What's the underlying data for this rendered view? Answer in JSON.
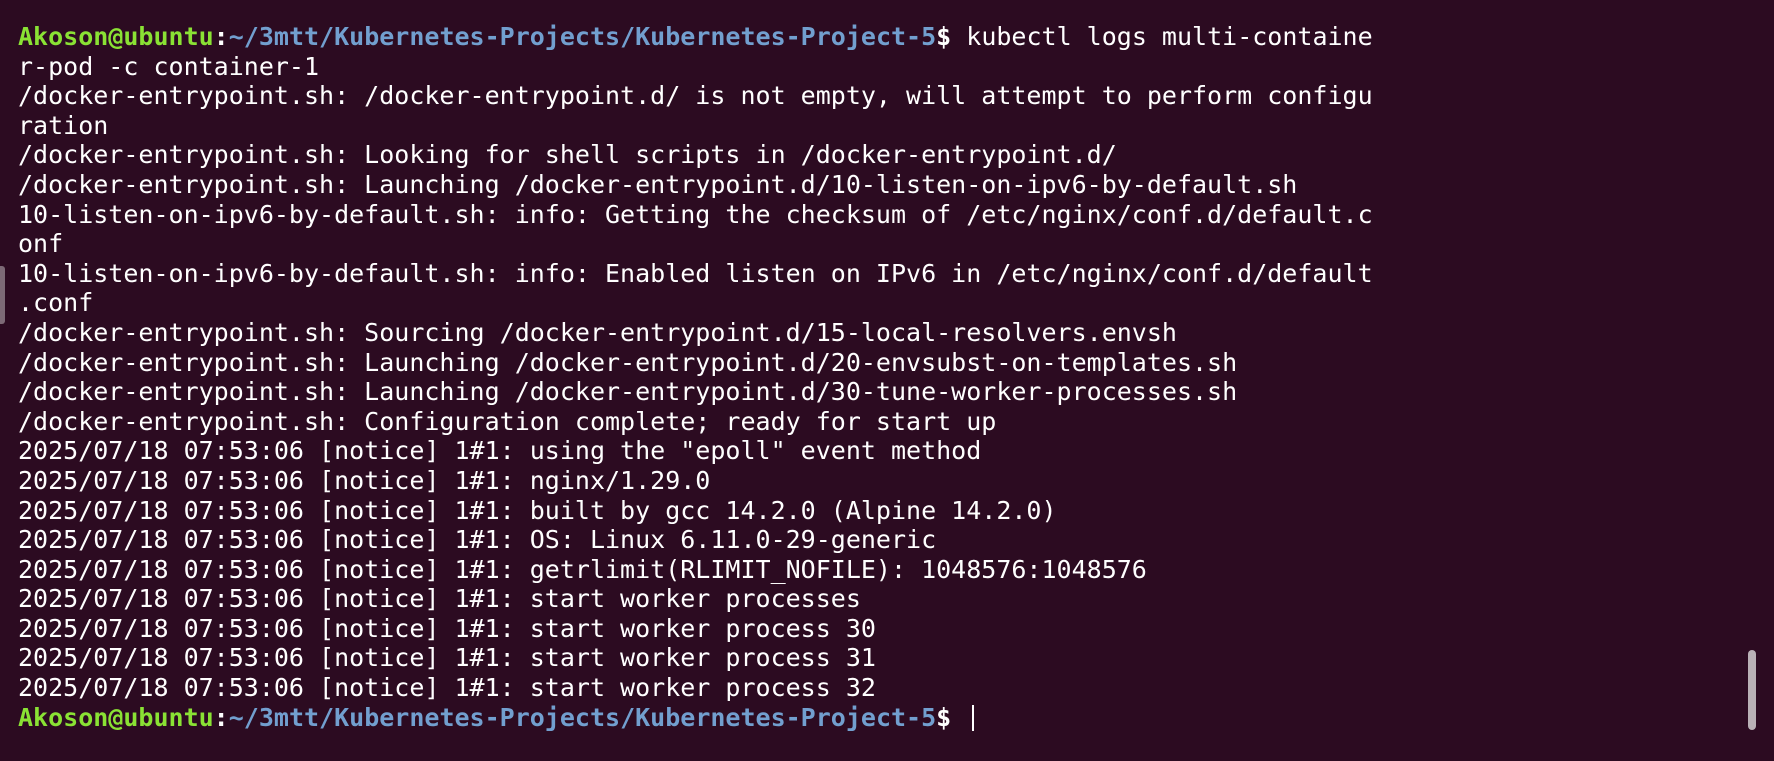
{
  "prompt": {
    "user_host": "Akoson@ubuntu",
    "colon": ":",
    "path": "~/3mtt/Kubernetes-Projects/Kubernetes-Project-5",
    "dollar": "$ "
  },
  "command": "kubectl logs multi-containe",
  "output_lines": [
    "r-pod -c container-1",
    "/docker-entrypoint.sh: /docker-entrypoint.d/ is not empty, will attempt to perform configu",
    "ration",
    "/docker-entrypoint.sh: Looking for shell scripts in /docker-entrypoint.d/",
    "/docker-entrypoint.sh: Launching /docker-entrypoint.d/10-listen-on-ipv6-by-default.sh",
    "10-listen-on-ipv6-by-default.sh: info: Getting the checksum of /etc/nginx/conf.d/default.c",
    "onf",
    "10-listen-on-ipv6-by-default.sh: info: Enabled listen on IPv6 in /etc/nginx/conf.d/default",
    ".conf",
    "/docker-entrypoint.sh: Sourcing /docker-entrypoint.d/15-local-resolvers.envsh",
    "/docker-entrypoint.sh: Launching /docker-entrypoint.d/20-envsubst-on-templates.sh",
    "/docker-entrypoint.sh: Launching /docker-entrypoint.d/30-tune-worker-processes.sh",
    "/docker-entrypoint.sh: Configuration complete; ready for start up",
    "2025/07/18 07:53:06 [notice] 1#1: using the \"epoll\" event method",
    "2025/07/18 07:53:06 [notice] 1#1: nginx/1.29.0",
    "2025/07/18 07:53:06 [notice] 1#1: built by gcc 14.2.0 (Alpine 14.2.0)",
    "2025/07/18 07:53:06 [notice] 1#1: OS: Linux 6.11.0-29-generic",
    "2025/07/18 07:53:06 [notice] 1#1: getrlimit(RLIMIT_NOFILE): 1048576:1048576",
    "2025/07/18 07:53:06 [notice] 1#1: start worker processes",
    "2025/07/18 07:53:06 [notice] 1#1: start worker process 30",
    "2025/07/18 07:53:06 [notice] 1#1: start worker process 31",
    "2025/07/18 07:53:06 [notice] 1#1: start worker process 32"
  ],
  "colors": {
    "background": "#2c0b21",
    "text": "#ffffff",
    "prompt_user": "#8ae234",
    "prompt_path": "#729fcf"
  }
}
